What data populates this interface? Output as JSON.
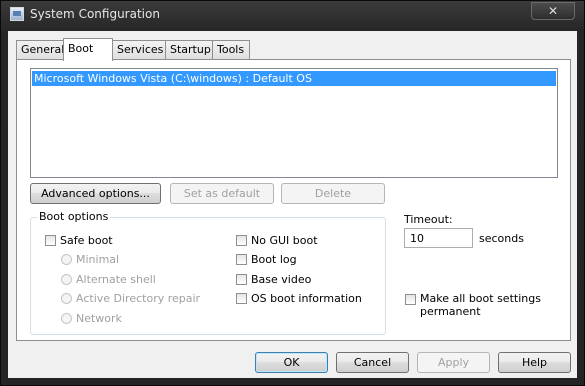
{
  "window": {
    "title": "System Configuration",
    "close_glyph": "✕",
    "app_icon": "msconfig-icon"
  },
  "tabs": [
    {
      "label": "General",
      "active": false
    },
    {
      "label": "Boot",
      "active": true
    },
    {
      "label": "Services",
      "active": false
    },
    {
      "label": "Startup",
      "active": false
    },
    {
      "label": "Tools",
      "active": false
    }
  ],
  "boot": {
    "os_list": [
      "Microsoft Windows Vista (C:\\windows) : Default OS"
    ],
    "selected_os_index": 0,
    "buttons": {
      "advanced": "Advanced options...",
      "set_default": "Set as default",
      "delete": "Delete"
    },
    "boot_options": {
      "title": "Boot options",
      "safe_boot": {
        "label": "Safe boot",
        "checked": false
      },
      "minimal": "Minimal",
      "alternate_shell": "Alternate shell",
      "active_directory_repair": "Active Directory repair",
      "network": "Network",
      "no_gui_boot": {
        "label": "No GUI boot",
        "checked": false
      },
      "boot_log": {
        "label": "Boot log",
        "checked": false
      },
      "base_video": {
        "label": "Base video",
        "checked": false
      },
      "os_boot_info": {
        "label": "OS boot information",
        "checked": false
      }
    },
    "timeout": {
      "label": "Timeout:",
      "value": "10",
      "unit": "seconds"
    },
    "make_permanent": {
      "line1": "Make all boot settings",
      "line2": "permanent",
      "checked": false
    }
  },
  "footer": {
    "ok": "OK",
    "cancel": "Cancel",
    "apply": "Apply",
    "help": "Help"
  },
  "colors": {
    "selection": "#3399ff",
    "dialog_bg": "#f0f0f0",
    "titlebar": "#2b2b2b"
  }
}
